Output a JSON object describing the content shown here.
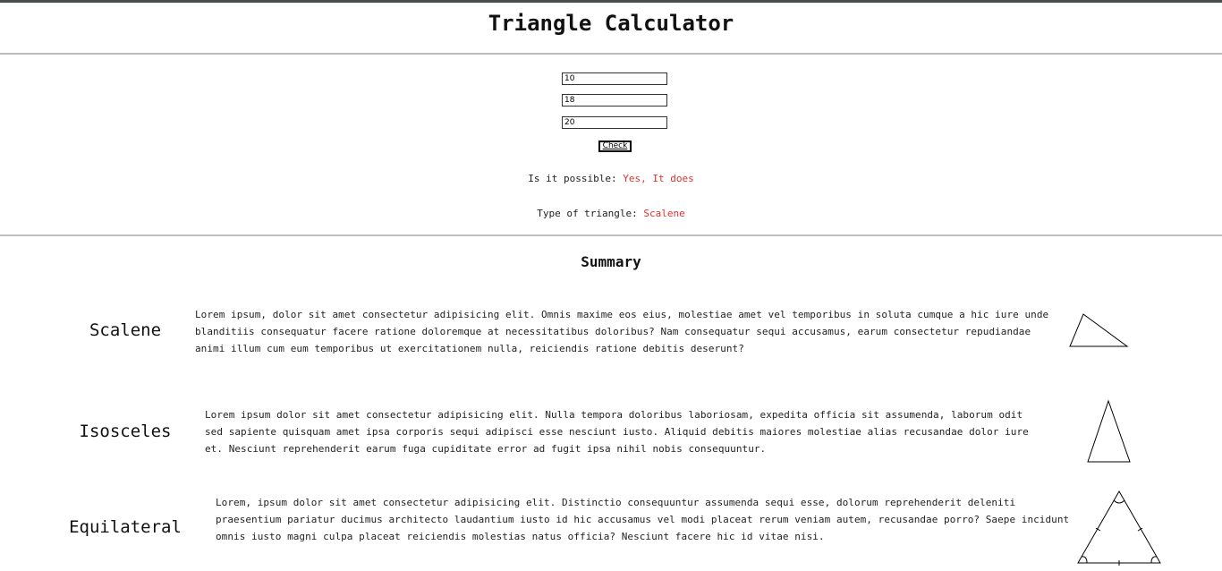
{
  "header": {
    "title": "Triangle Calculator"
  },
  "form": {
    "side_a": "10",
    "side_b": "18",
    "side_c": "20",
    "check_label": "Check"
  },
  "results": {
    "possible_label": "Is it possible:",
    "possible_value": "Yes, It does",
    "type_label": "Type of triangle:",
    "type_value": "Scalene",
    "value_color": "#e0322f"
  },
  "summary": {
    "title": "Summary",
    "items": [
      {
        "name": "Scalene",
        "icon": "scalene-triangle-icon",
        "text": "Lorem ipsum, dolor sit amet consectetur adipisicing elit. Omnis maxime eos eius, molestiae amet vel temporibus in soluta cumque a hic iure unde blanditiis consequatur facere ratione doloremque at necessitatibus doloribus? Nam consequatur sequi accusamus, earum consectetur repudiandae animi illum cum eum temporibus ut exercitationem nulla, reiciendis ratione debitis deserunt?"
      },
      {
        "name": "Isosceles",
        "icon": "isosceles-triangle-icon",
        "text": "Lorem ipsum dolor sit amet consectetur adipisicing elit. Nulla tempora doloribus laboriosam, expedita officia sit assumenda, laborum odit sed sapiente quisquam amet ipsa corporis sequi adipisci esse nesciunt iusto. Aliquid debitis maiores molestiae alias recusandae dolor iure et. Nesciunt reprehenderit earum fuga cupiditate error ad fugit ipsa nihil nobis consequuntur."
      },
      {
        "name": "Equilateral",
        "icon": "equilateral-triangle-icon",
        "text": "Lorem, ipsum dolor sit amet consectetur adipisicing elit. Distinctio consequuntur assumenda sequi esse, dolorum reprehenderit deleniti praesentium pariatur ducimus architecto laudantium iusto id hic accusamus vel modi placeat rerum veniam autem, recusandae porro? Saepe incidunt omnis iusto magni culpa placeat reiciendis molestias natus officia? Nesciunt facere hic id vitae nisi."
      }
    ]
  }
}
